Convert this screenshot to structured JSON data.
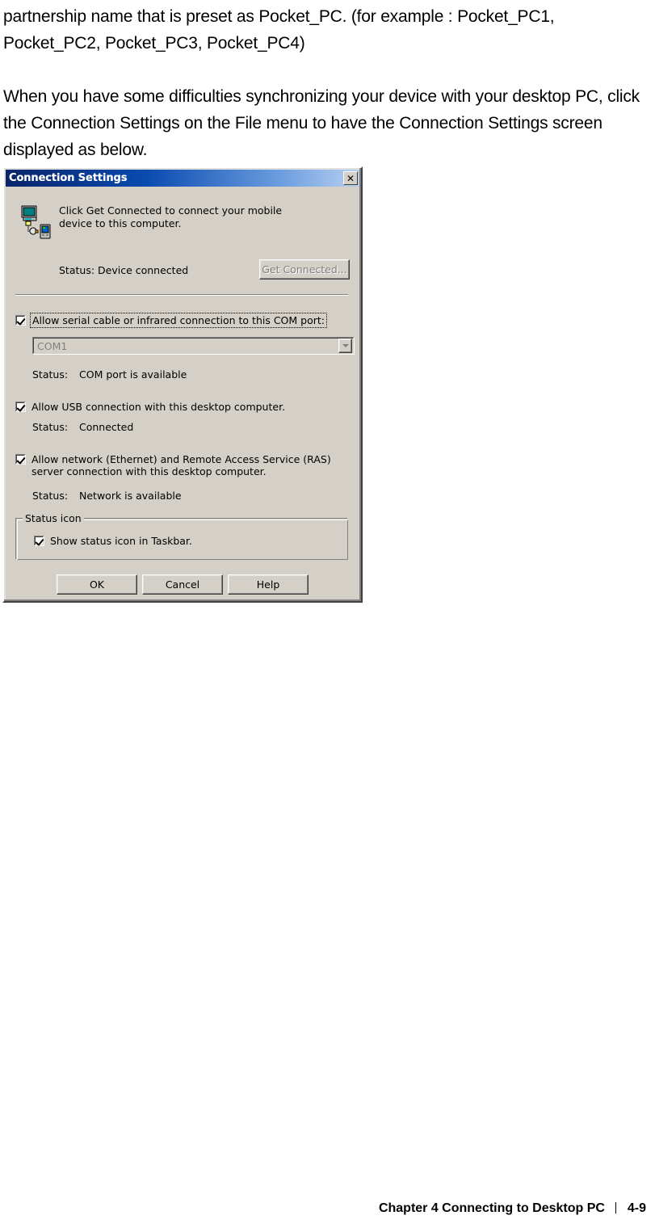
{
  "page": {
    "paragraphs": [
      "partnership name that is preset as Pocket_PC. (for example :\nPocket_PC1, Pocket_PC2, Pocket_PC3, Pocket_PC4)",
      "When you have some difficulties synchronizing your device with your desktop PC, click the Connection Settings on the File menu to have the Connection Settings screen displayed as below."
    ],
    "footer": {
      "chapter": "Chapter 4 Connecting to Desktop PC",
      "page_number": "4-9"
    }
  },
  "dialog": {
    "title": "Connection Settings",
    "close_label": "✕",
    "intro": "Click Get Connected to connect your mobile device to this computer.",
    "device_status": "Status: Device connected",
    "get_connected_button": "Get Connected...",
    "serial": {
      "checkbox_label": "Allow serial cable or infrared connection to this COM port:",
      "checked": true,
      "focused": true,
      "combo_value": "COM1",
      "status_label": "Status:",
      "status_value": "COM port is available"
    },
    "usb": {
      "checkbox_label": "Allow USB connection with this desktop computer.",
      "checked": true,
      "status_label": "Status:",
      "status_value": "Connected"
    },
    "network": {
      "checkbox_label": "Allow network (Ethernet) and Remote Access Service (RAS)\nserver connection with this desktop computer.",
      "checked": true,
      "status_label": "Status:",
      "status_value": "Network is available"
    },
    "status_icon_group": {
      "title": "Status icon",
      "checkbox_label": "Show status icon in Taskbar.",
      "checked": true
    },
    "buttons": {
      "ok": "OK",
      "cancel": "Cancel",
      "help": "Help"
    }
  },
  "colors": {
    "dialog_face": "#d4d0c8",
    "titlebar_start": "#0a246a",
    "titlebar_end": "#b7d0ef",
    "disabled_text": "#808080"
  }
}
